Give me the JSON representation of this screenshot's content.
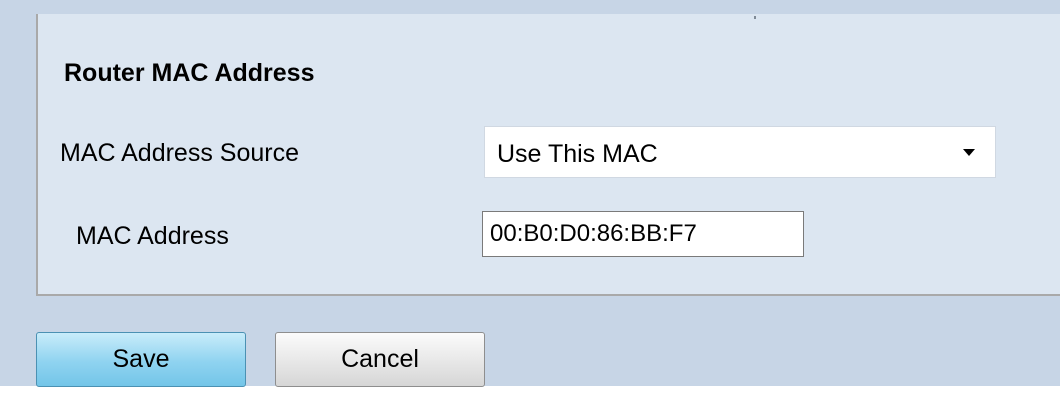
{
  "section": {
    "title": "Router MAC Address"
  },
  "fields": {
    "mac_source": {
      "label": "MAC Address Source",
      "selected": "Use This MAC"
    },
    "mac_address": {
      "label": "MAC Address",
      "value": "00:B0:D0:86:BB:F7"
    }
  },
  "buttons": {
    "save": "Save",
    "cancel": "Cancel"
  },
  "colors": {
    "panel_background": "#dce6f1",
    "outer_background": "#c7d5e6",
    "save_button": "#8fd3f0",
    "cancel_button": "#e7e7e7"
  }
}
